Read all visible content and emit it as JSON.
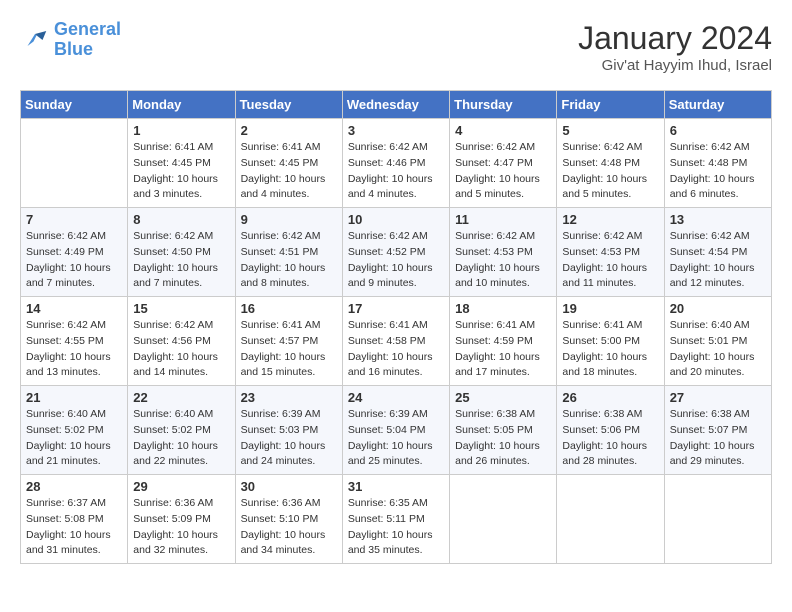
{
  "logo": {
    "line1": "General",
    "line2": "Blue"
  },
  "header": {
    "title": "January 2024",
    "subtitle": "Giv'at Hayyim Ihud, Israel"
  },
  "columns": [
    "Sunday",
    "Monday",
    "Tuesday",
    "Wednesday",
    "Thursday",
    "Friday",
    "Saturday"
  ],
  "weeks": [
    [
      {
        "day": "",
        "info": ""
      },
      {
        "day": "1",
        "info": "Sunrise: 6:41 AM\nSunset: 4:45 PM\nDaylight: 10 hours\nand 3 minutes."
      },
      {
        "day": "2",
        "info": "Sunrise: 6:41 AM\nSunset: 4:45 PM\nDaylight: 10 hours\nand 4 minutes."
      },
      {
        "day": "3",
        "info": "Sunrise: 6:42 AM\nSunset: 4:46 PM\nDaylight: 10 hours\nand 4 minutes."
      },
      {
        "day": "4",
        "info": "Sunrise: 6:42 AM\nSunset: 4:47 PM\nDaylight: 10 hours\nand 5 minutes."
      },
      {
        "day": "5",
        "info": "Sunrise: 6:42 AM\nSunset: 4:48 PM\nDaylight: 10 hours\nand 5 minutes."
      },
      {
        "day": "6",
        "info": "Sunrise: 6:42 AM\nSunset: 4:48 PM\nDaylight: 10 hours\nand 6 minutes."
      }
    ],
    [
      {
        "day": "7",
        "info": "Sunrise: 6:42 AM\nSunset: 4:49 PM\nDaylight: 10 hours\nand 7 minutes."
      },
      {
        "day": "8",
        "info": "Sunrise: 6:42 AM\nSunset: 4:50 PM\nDaylight: 10 hours\nand 7 minutes."
      },
      {
        "day": "9",
        "info": "Sunrise: 6:42 AM\nSunset: 4:51 PM\nDaylight: 10 hours\nand 8 minutes."
      },
      {
        "day": "10",
        "info": "Sunrise: 6:42 AM\nSunset: 4:52 PM\nDaylight: 10 hours\nand 9 minutes."
      },
      {
        "day": "11",
        "info": "Sunrise: 6:42 AM\nSunset: 4:53 PM\nDaylight: 10 hours\nand 10 minutes."
      },
      {
        "day": "12",
        "info": "Sunrise: 6:42 AM\nSunset: 4:53 PM\nDaylight: 10 hours\nand 11 minutes."
      },
      {
        "day": "13",
        "info": "Sunrise: 6:42 AM\nSunset: 4:54 PM\nDaylight: 10 hours\nand 12 minutes."
      }
    ],
    [
      {
        "day": "14",
        "info": "Sunrise: 6:42 AM\nSunset: 4:55 PM\nDaylight: 10 hours\nand 13 minutes."
      },
      {
        "day": "15",
        "info": "Sunrise: 6:42 AM\nSunset: 4:56 PM\nDaylight: 10 hours\nand 14 minutes."
      },
      {
        "day": "16",
        "info": "Sunrise: 6:41 AM\nSunset: 4:57 PM\nDaylight: 10 hours\nand 15 minutes."
      },
      {
        "day": "17",
        "info": "Sunrise: 6:41 AM\nSunset: 4:58 PM\nDaylight: 10 hours\nand 16 minutes."
      },
      {
        "day": "18",
        "info": "Sunrise: 6:41 AM\nSunset: 4:59 PM\nDaylight: 10 hours\nand 17 minutes."
      },
      {
        "day": "19",
        "info": "Sunrise: 6:41 AM\nSunset: 5:00 PM\nDaylight: 10 hours\nand 18 minutes."
      },
      {
        "day": "20",
        "info": "Sunrise: 6:40 AM\nSunset: 5:01 PM\nDaylight: 10 hours\nand 20 minutes."
      }
    ],
    [
      {
        "day": "21",
        "info": "Sunrise: 6:40 AM\nSunset: 5:02 PM\nDaylight: 10 hours\nand 21 minutes."
      },
      {
        "day": "22",
        "info": "Sunrise: 6:40 AM\nSunset: 5:02 PM\nDaylight: 10 hours\nand 22 minutes."
      },
      {
        "day": "23",
        "info": "Sunrise: 6:39 AM\nSunset: 5:03 PM\nDaylight: 10 hours\nand 24 minutes."
      },
      {
        "day": "24",
        "info": "Sunrise: 6:39 AM\nSunset: 5:04 PM\nDaylight: 10 hours\nand 25 minutes."
      },
      {
        "day": "25",
        "info": "Sunrise: 6:38 AM\nSunset: 5:05 PM\nDaylight: 10 hours\nand 26 minutes."
      },
      {
        "day": "26",
        "info": "Sunrise: 6:38 AM\nSunset: 5:06 PM\nDaylight: 10 hours\nand 28 minutes."
      },
      {
        "day": "27",
        "info": "Sunrise: 6:38 AM\nSunset: 5:07 PM\nDaylight: 10 hours\nand 29 minutes."
      }
    ],
    [
      {
        "day": "28",
        "info": "Sunrise: 6:37 AM\nSunset: 5:08 PM\nDaylight: 10 hours\nand 31 minutes."
      },
      {
        "day": "29",
        "info": "Sunrise: 6:36 AM\nSunset: 5:09 PM\nDaylight: 10 hours\nand 32 minutes."
      },
      {
        "day": "30",
        "info": "Sunrise: 6:36 AM\nSunset: 5:10 PM\nDaylight: 10 hours\nand 34 minutes."
      },
      {
        "day": "31",
        "info": "Sunrise: 6:35 AM\nSunset: 5:11 PM\nDaylight: 10 hours\nand 35 minutes."
      },
      {
        "day": "",
        "info": ""
      },
      {
        "day": "",
        "info": ""
      },
      {
        "day": "",
        "info": ""
      }
    ]
  ]
}
